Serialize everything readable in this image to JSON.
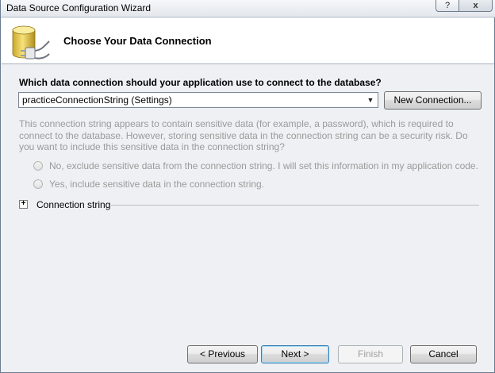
{
  "window": {
    "title": "Data Source Configuration Wizard",
    "help_label": "?",
    "close_label": "x"
  },
  "header": {
    "heading": "Choose Your Data Connection",
    "icon": "database-plug-icon"
  },
  "connection": {
    "question": "Which data connection should your application use to connect to the database?",
    "selected": "practiceConnectionString (Settings)",
    "new_connection_label": "New Connection..."
  },
  "sensitive": {
    "info": "This connection string appears to contain sensitive data (for example, a password), which is required to connect to the database. However, storing sensitive data in the connection string can be a security risk. Do you want to include this sensitive data in the connection string?",
    "option_exclude": "No, exclude sensitive data from the connection string. I will set this information in my application code.",
    "option_include": "Yes, include sensitive data in the connection string."
  },
  "expander": {
    "label": "Connection string",
    "toggle_glyph": "+"
  },
  "footer": {
    "previous_label": "< Previous",
    "next_label": "Next >",
    "finish_label": "Finish",
    "cancel_label": "Cancel"
  },
  "colors": {
    "window_bg": "#eef0f3",
    "header_bg": "#ffffff",
    "disabled_text": "#9a9a9a",
    "default_button_border": "#3c7fb1"
  }
}
